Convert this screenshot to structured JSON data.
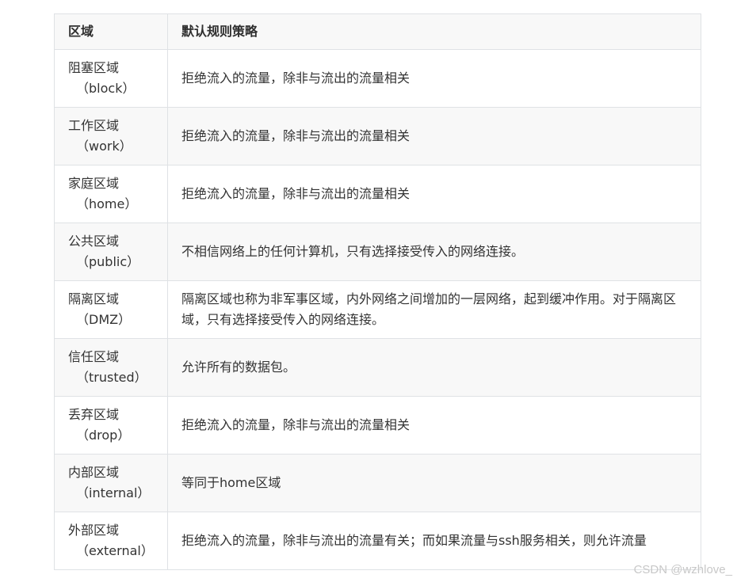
{
  "table": {
    "headers": {
      "zone": "区域",
      "policy": "默认规则策略"
    },
    "rows": [
      {
        "zone_cn": "阻塞区域",
        "zone_en": "（block）",
        "policy": "拒绝流入的流量，除非与流出的流量相关"
      },
      {
        "zone_cn": "工作区域",
        "zone_en": "（work）",
        "policy": "拒绝流入的流量，除非与流出的流量相关"
      },
      {
        "zone_cn": "家庭区域",
        "zone_en": "（home）",
        "policy": "拒绝流入的流量，除非与流出的流量相关"
      },
      {
        "zone_cn": "公共区域",
        "zone_en": "（public）",
        "policy": "不相信网络上的任何计算机，只有选择接受传入的网络连接。"
      },
      {
        "zone_cn": "隔离区域",
        "zone_en": "（DMZ）",
        "policy": "隔离区域也称为非军事区域，内外网络之间增加的一层网络，起到缓冲作用。对于隔离区域，只有选择接受传入的网络连接。"
      },
      {
        "zone_cn": "信任区域",
        "zone_en": "（trusted）",
        "policy": "允许所有的数据包。"
      },
      {
        "zone_cn": "丢弃区域",
        "zone_en": "（drop）",
        "policy": "拒绝流入的流量，除非与流出的流量相关"
      },
      {
        "zone_cn": "内部区域",
        "zone_en": "（internal）",
        "policy": "等同于home区域"
      },
      {
        "zone_cn": "外部区域",
        "zone_en": "（external）",
        "policy": "拒绝流入的流量，除非与流出的流量有关；而如果流量与ssh服务相关，则允许流量"
      }
    ]
  },
  "watermark": "CSDN @wzhlove_"
}
